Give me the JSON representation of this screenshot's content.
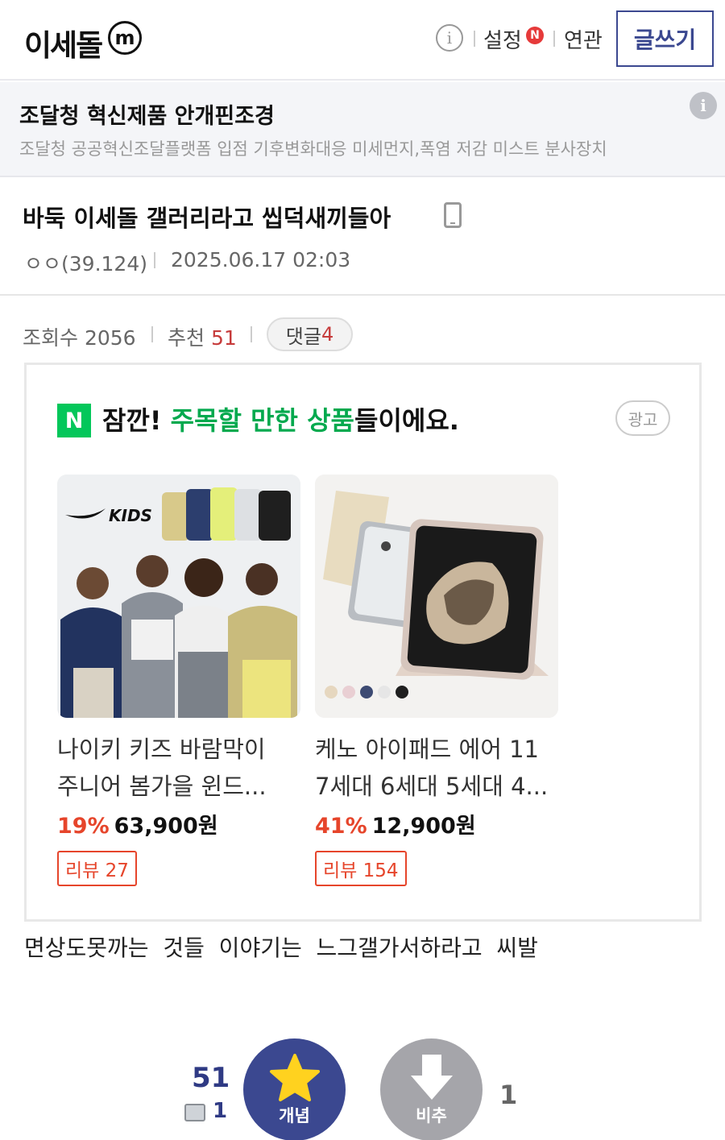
{
  "header": {
    "gallery_name": "이세돌",
    "minor_badge": "m",
    "info_icon": "i",
    "settings_label": "설정",
    "settings_badge": "N",
    "related_label": "연관",
    "write_label": "글쓰기"
  },
  "ad_banner": {
    "title": "조달청 혁신제품 안개핀조경",
    "description": "조달청 공공혁신조달플랫폼 입점 기후변화대응 미세먼지,폭염 저감 미스트 분사장치",
    "info_icon": "i"
  },
  "post": {
    "title": "바둑 이세돌 갤러리라고 씹덕새끼들아",
    "author": "ㅇㅇ(39.124)",
    "date": "2025.06.17 02:03",
    "views_label": "조회수 2056",
    "recommend_label": "추천",
    "recommend_count": "51",
    "comment_label": "댓글",
    "comment_count": "4",
    "body": "면상도못까는  것들  이야기는  느그갤가서하라고  씨발"
  },
  "product_ad": {
    "logo": "N",
    "headline_prefix": "잠깐! ",
    "headline_highlight": "주목할 만한 상품",
    "headline_suffix": "들이에요.",
    "ad_label": "광고",
    "products": [
      {
        "name_line1": "나이키 키즈 바람막이",
        "name_line2": "주니어 봄가을 윈드...",
        "discount": "19%",
        "price": "63,900원",
        "review": "리뷰 27",
        "image_text": "KIDS"
      },
      {
        "name_line1": "케노 아이패드 에어 11",
        "name_line2": "7세대 6세대 5세대 4...",
        "discount": "41%",
        "price": "12,900원",
        "review": "리뷰 154"
      }
    ]
  },
  "vote": {
    "up_count": "51",
    "fixed_count": "1",
    "up_label": "개념",
    "down_label": "비추",
    "down_count": "1"
  },
  "colors": {
    "brand_navy": "#3b4890",
    "naver_green": "#03c75a",
    "accent_red": "#e6452b"
  }
}
